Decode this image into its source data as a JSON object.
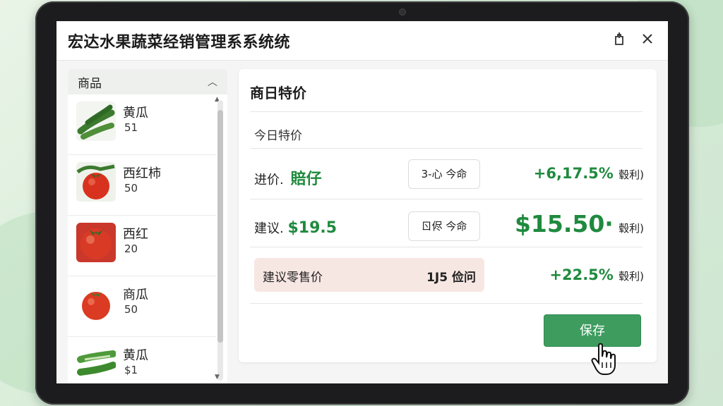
{
  "window": {
    "title": "宏达水果蔬菜经销管理系系统统"
  },
  "sidebar": {
    "header": "商品",
    "items": [
      {
        "name": "黄瓜",
        "num": "51",
        "image": "cucumber-thumbnail"
      },
      {
        "name": "西红柿",
        "num": "50",
        "image": "tomato-thumbnail"
      },
      {
        "name": "西红",
        "num": "20",
        "image": "tomato-thumbnail"
      },
      {
        "name": "商瓜",
        "num": "50",
        "image": "tomato-thumbnail"
      },
      {
        "name": "黄瓜",
        "num": "$1",
        "image": "cucumber-thumbnail"
      }
    ]
  },
  "panel": {
    "title": "商日特价",
    "subtitle": "今日特价",
    "row1": {
      "label": "进价.",
      "value": "賠仔",
      "button": "3-心 今命",
      "pct": "+6,17.5%",
      "pct_note": "毂利)"
    },
    "row2": {
      "label": "建议.",
      "value": "$19.5",
      "button": "ㄖ侭 今命",
      "pct": "$15.50·",
      "pct_note": "毂利)"
    },
    "row3": {
      "label": "建议零售价",
      "value": "1J5 俭问",
      "pct": "+22.5%",
      "pct_note": "毂利)"
    },
    "save": "保存"
  },
  "colors": {
    "accent": "#3e9c5f",
    "profit": "#1f8a3e",
    "highlight_row": "#f7e7e3"
  }
}
